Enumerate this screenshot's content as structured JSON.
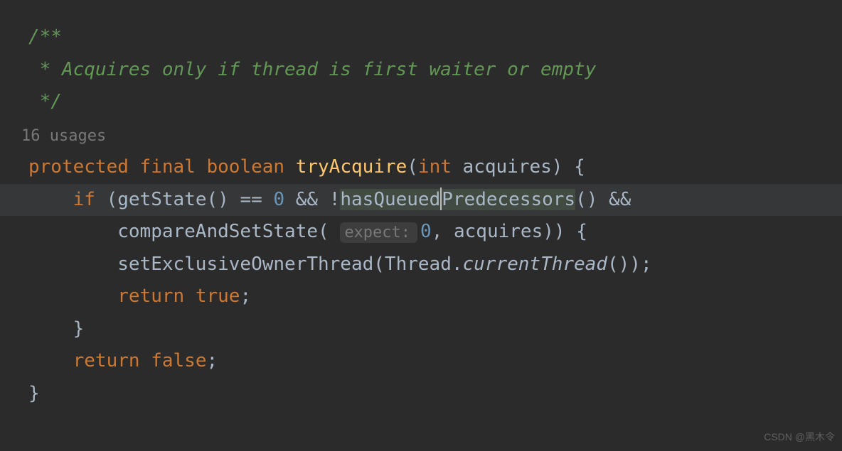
{
  "comment": {
    "open": "/**",
    "body": " * Acquires only if thread is first waiter or empty",
    "close": " */"
  },
  "usages_label": "16 usages",
  "code": {
    "kw_protected": "protected",
    "kw_final": "final",
    "kw_boolean": "boolean",
    "method_name": "tryAcquire",
    "paren_open": "(",
    "kw_int": "int",
    "param_name": "acquires",
    "paren_close_brace": ") {",
    "kw_if": "if",
    "if_open": "(",
    "call_getState": "getState",
    "empty_parens": "()",
    "op_eq": " == ",
    "zero": "0",
    "op_and": " && ",
    "op_not": "!",
    "call_hasQueued_a": "hasQueued",
    "call_hasQueued_b": "Predecessors",
    "call_compareAndSetState": "compareAndSetState",
    "hint_expect": "expect:",
    "comma_sp": ", ",
    "arg_acquires": "acquires",
    "close_paren_brace": ")) {",
    "call_setExclusiveOwnerThread": "setExclusiveOwnerThread",
    "call_Thread": "Thread",
    "dot": ".",
    "call_currentThread": "currentThread",
    "tail_close": "());",
    "kw_return": "return",
    "kw_true": "true",
    "semi": ";",
    "close_brace": "}",
    "kw_false": "false"
  },
  "watermark": "CSDN @黑木令"
}
